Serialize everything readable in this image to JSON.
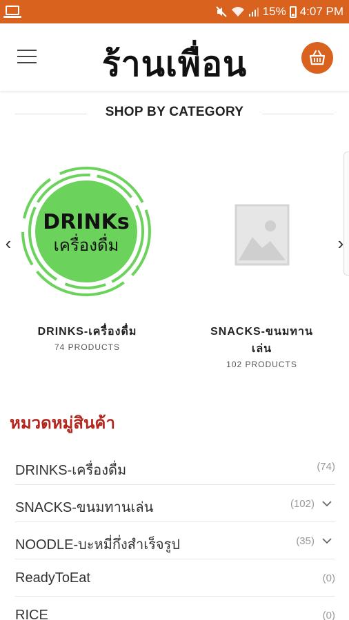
{
  "status_bar": {
    "battery": "15%",
    "time": "4:07 PM",
    "icons": [
      "laptop-icon",
      "mute-icon",
      "wifi-icon",
      "signal-icon",
      "battery-icon"
    ]
  },
  "header": {
    "logo_text": "ร้านเพื่อน",
    "menu_icon": "hamburger-icon",
    "cart_icon": "basket-icon",
    "accent_color": "#d9621e"
  },
  "shop_by_category": {
    "title": "SHOP BY CATEGORY",
    "categories": [
      {
        "name": "DRINKS-เครื่องดื่ม",
        "count": "74 PRODUCTS",
        "image": {
          "line1": "DRINKs",
          "line2": "เครื่องดื่ม",
          "color": "#6bd35c"
        }
      },
      {
        "name_line1": "SNACKS-ขนมทาน",
        "name_line2": "เล่น",
        "count": "102 PRODUCTS",
        "image": {
          "type": "placeholder-image-icon"
        }
      }
    ]
  },
  "product_categories": {
    "title": "หมวดหมู่สินค้า",
    "title_color": "#b3261e",
    "items": [
      {
        "label": "DRINKS-เครื่องดื่ม",
        "count": "(74)",
        "expandable": false
      },
      {
        "label": "SNACKS-ขนมทานเล่น",
        "count": "(102)",
        "expandable": true
      },
      {
        "label": "NOODLE-บะหมี่กึ่งสำเร็จรูป",
        "count": "(35)",
        "expandable": true
      },
      {
        "label": "ReadyToEat",
        "count": "(0)",
        "expandable": false
      },
      {
        "label": "RICE",
        "count": "(0)",
        "expandable": false
      }
    ]
  }
}
